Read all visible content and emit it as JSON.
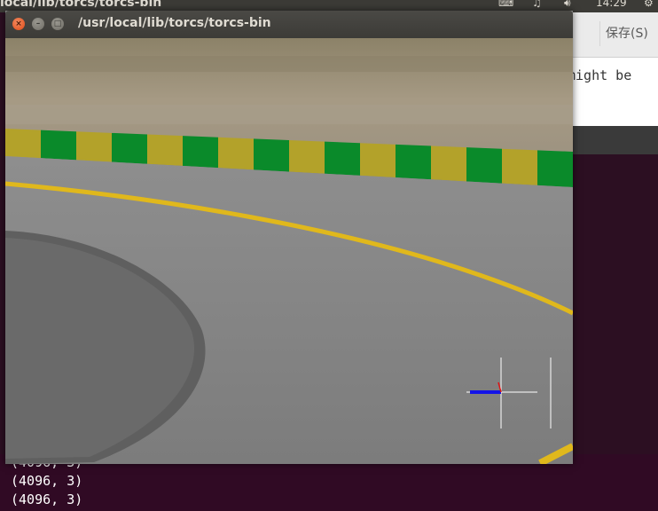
{
  "top_panel": {
    "behind_window_title": "local/lib/torcs/torcs-bin",
    "clock": "14:29"
  },
  "background_editor": {
    "save_label": "保存(S)",
    "visible_text": "might be"
  },
  "terminal": {
    "lines": [
      "(4096, 3)",
      "(4096, 3)",
      "(4096, 3)"
    ]
  },
  "torcs_window": {
    "title": "/usr/local/lib/torcs/torcs-bin",
    "close_glyph": "×",
    "minimize_glyph": "–",
    "maximize_glyph": "□"
  },
  "colors": {
    "curb_green": "#0a8a2a",
    "curb_yellow": "#b8a52a",
    "road_line": "#e8c21a",
    "asphalt": "#8a8a8a",
    "grass": "#9a8c76"
  }
}
